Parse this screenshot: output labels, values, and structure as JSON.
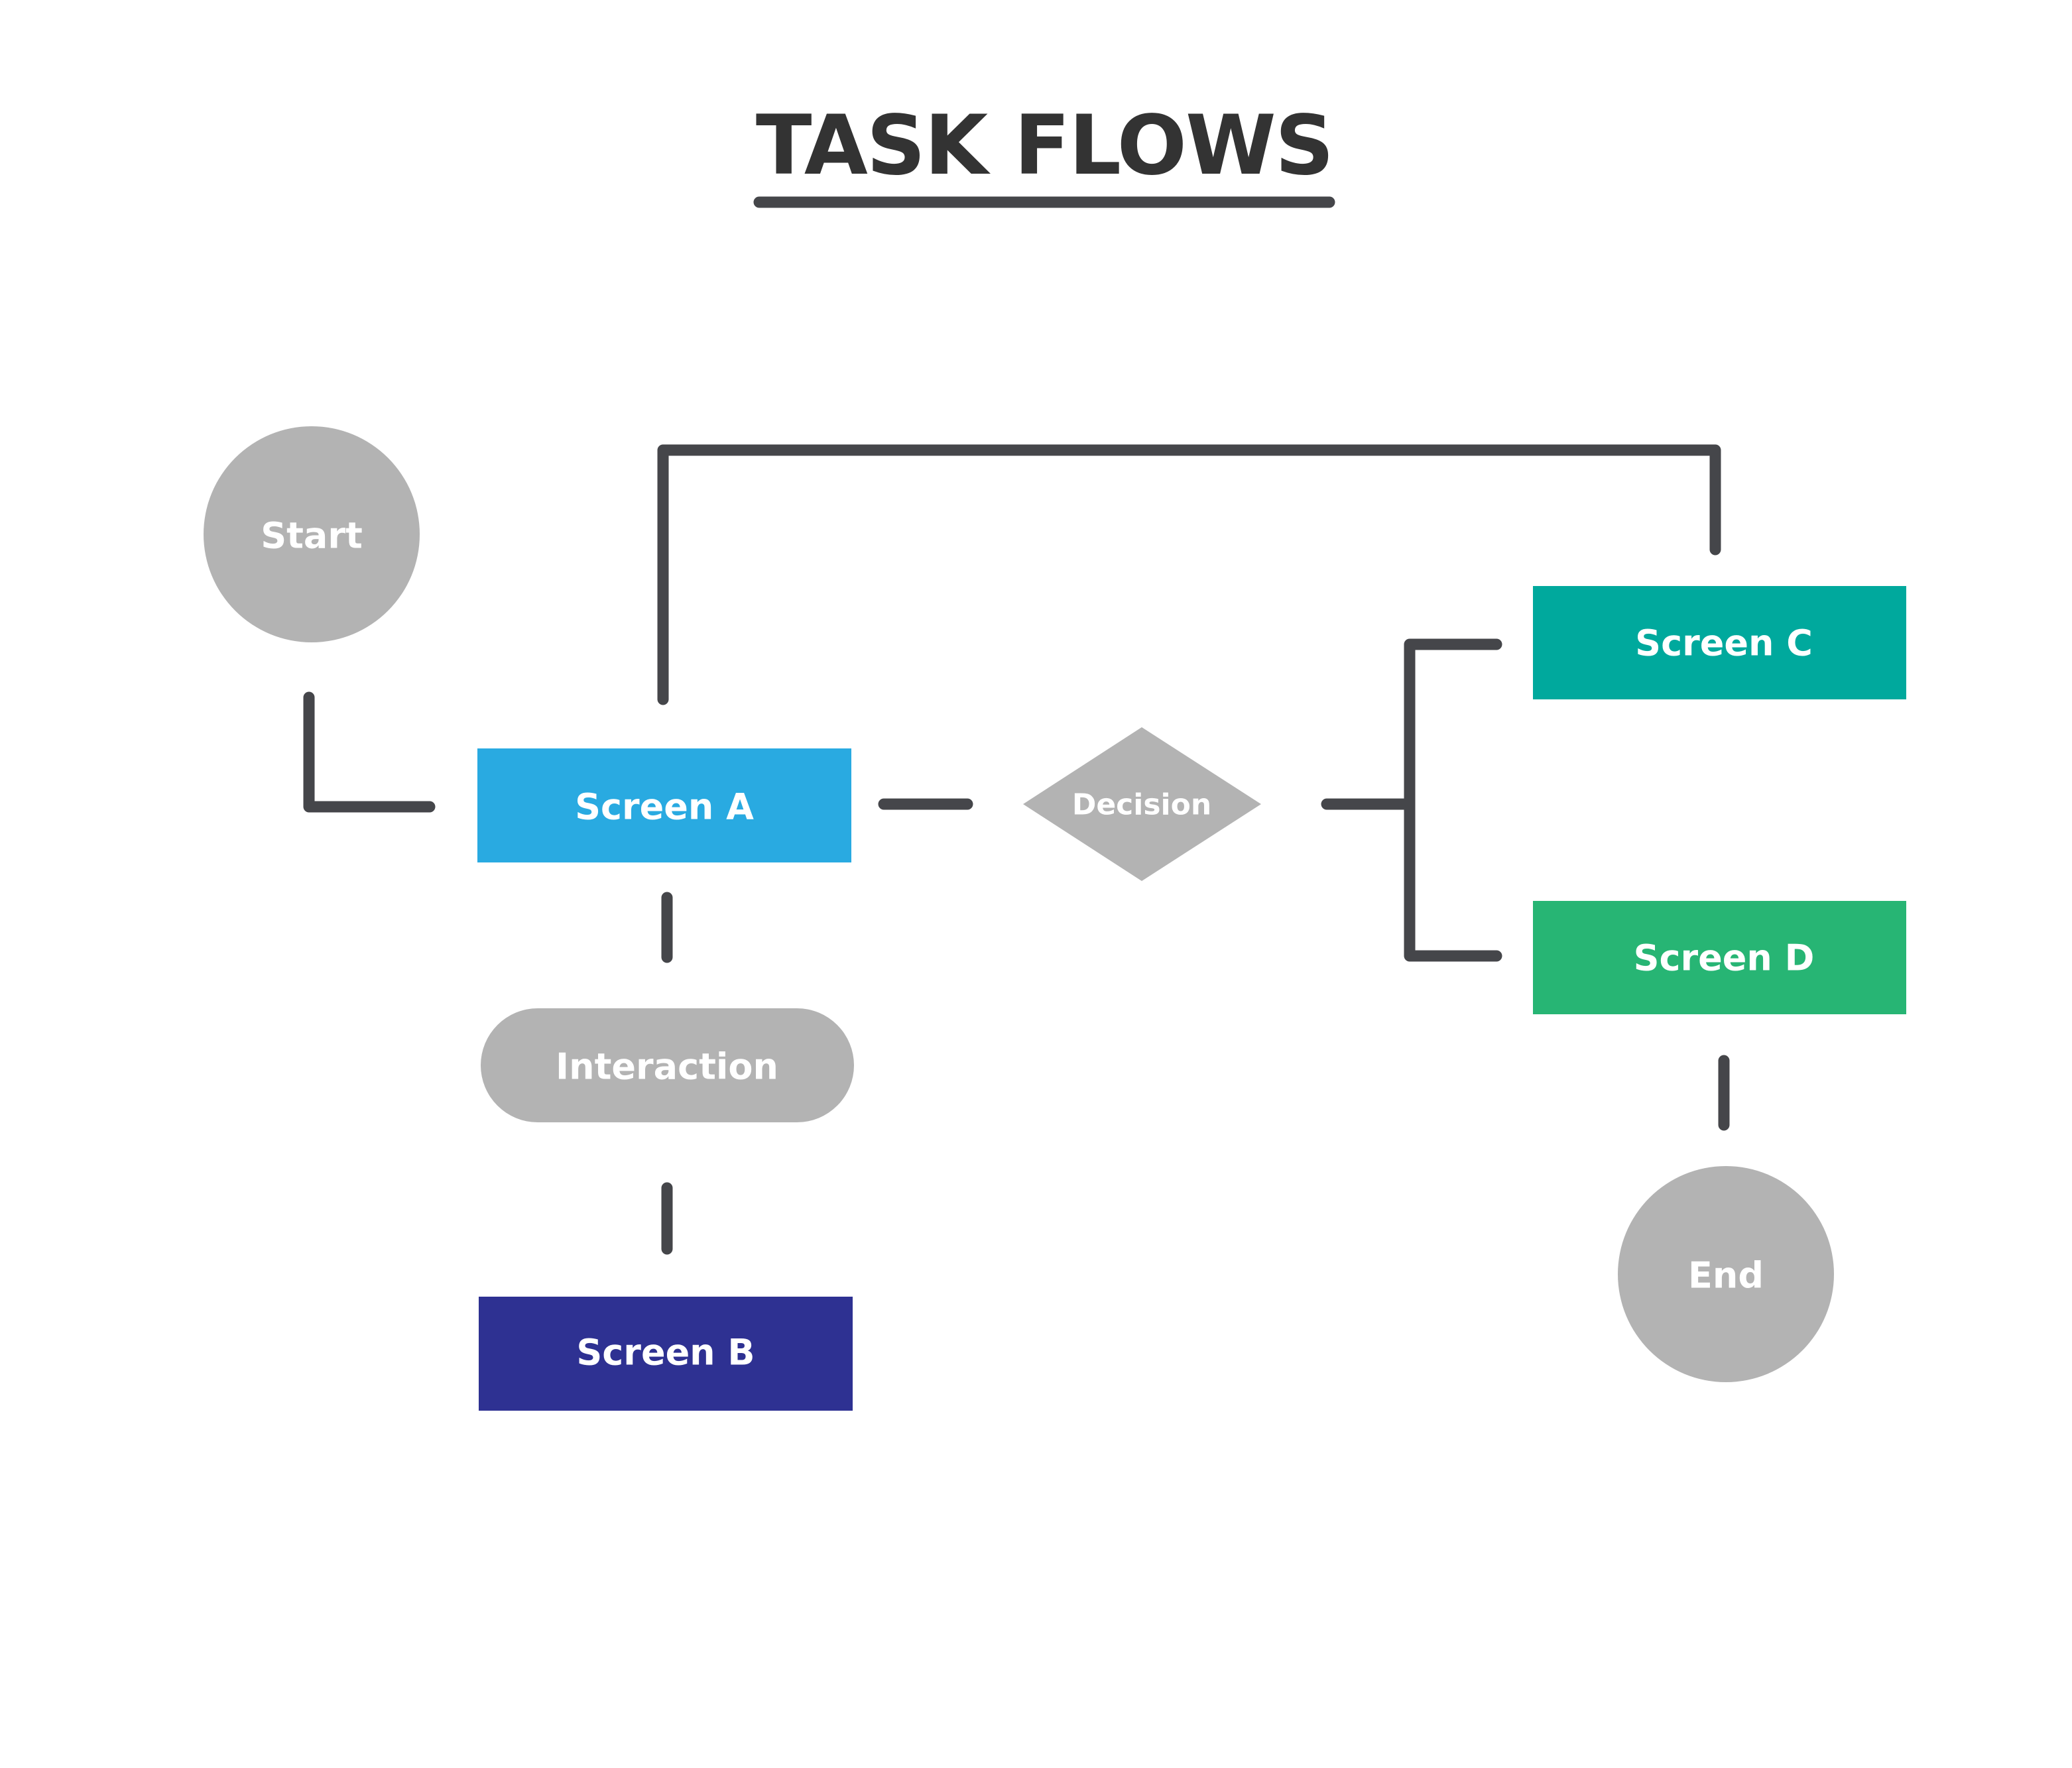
{
  "title": "TASK FLOWS",
  "colors": {
    "text_dark": "#333333",
    "connector": "#45464a",
    "neutral_shape": "#b3b3b3",
    "screen_a": "#29aae1",
    "screen_b": "#2e3192",
    "screen_c": "#00a99d",
    "screen_d": "#27b574",
    "label": "#ffffff"
  },
  "nodes": {
    "start": {
      "label": "Start",
      "shape": "circle"
    },
    "screen_a": {
      "label": "Screen A",
      "shape": "rectangle"
    },
    "interaction": {
      "label": "Interaction",
      "shape": "pill"
    },
    "screen_b": {
      "label": "Screen B",
      "shape": "rectangle"
    },
    "decision": {
      "label": "Decision",
      "shape": "diamond"
    },
    "screen_c": {
      "label": "Screen C",
      "shape": "rectangle"
    },
    "screen_d": {
      "label": "Screen D",
      "shape": "rectangle"
    },
    "end": {
      "label": "End",
      "shape": "circle"
    }
  },
  "edges": [
    {
      "from": "start",
      "to": "screen_a"
    },
    {
      "from": "screen_a",
      "to": "screen_c"
    },
    {
      "from": "screen_a",
      "to": "interaction"
    },
    {
      "from": "interaction",
      "to": "screen_b"
    },
    {
      "from": "screen_a",
      "to": "decision"
    },
    {
      "from": "decision",
      "to": "screen_c"
    },
    {
      "from": "decision",
      "to": "screen_d"
    },
    {
      "from": "screen_d",
      "to": "end"
    }
  ]
}
